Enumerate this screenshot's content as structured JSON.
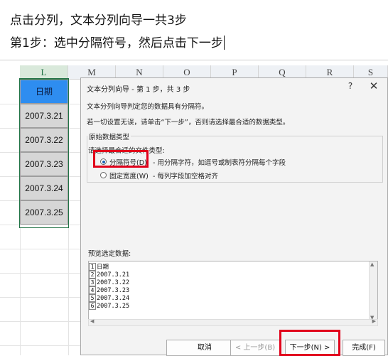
{
  "caption": {
    "line1": "点击分列，文本分列向导一共3步",
    "line2": "第1步：选中分隔符号，然后点击下一步"
  },
  "sheet": {
    "columns": [
      "L",
      "M",
      "N",
      "O",
      "P",
      "Q",
      "R",
      "S"
    ],
    "selected_column": "L",
    "cells": [
      "日期",
      "2007.3.21",
      "2007.3.22",
      "2007.3.23",
      "2007.3.24",
      "2007.3.25"
    ],
    "colors": {
      "header_fill": "#2e8df0",
      "data_fill": "#d6d6d6",
      "selection": "#217346"
    }
  },
  "dialog": {
    "title": "文本分列向导 - 第 1 步，共 3 步",
    "help_label": "?",
    "close_label": "✕",
    "intro_line1": "文本分列向导判定您的数据具有分隔符。",
    "intro_line2": "若一切设置无误，请单击“下一步”，否则请选择最合适的数据类型。",
    "group_title": "原始数据类型",
    "choose_label": "请选择最合适的文件类型:",
    "options": [
      {
        "label": "分隔符号(D)",
        "desc": "- 用分隔字符，如逗号或制表符分隔每个字段",
        "selected": true
      },
      {
        "label": "固定宽度(W)",
        "desc": "- 每列字段加空格对齐",
        "selected": false
      }
    ],
    "preview_label": "预览选定数据:",
    "preview_rows": [
      {
        "num": "1",
        "text": "日期"
      },
      {
        "num": "2",
        "text": "2007.3.21"
      },
      {
        "num": "3",
        "text": "2007.3.22"
      },
      {
        "num": "4",
        "text": "2007.3.23"
      },
      {
        "num": "5",
        "text": "2007.3.24"
      },
      {
        "num": "6",
        "text": "2007.3.25"
      }
    ],
    "buttons": {
      "cancel": "取消",
      "back": "< 上一步(B)",
      "next": "下一步(N) >",
      "finish": "完成(F)"
    },
    "highlight_color": "#e1001a"
  }
}
